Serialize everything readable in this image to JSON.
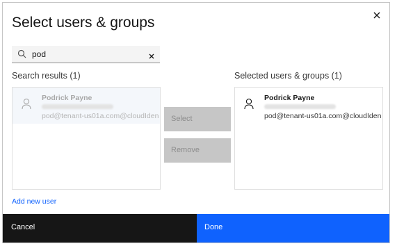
{
  "dialog": {
    "title": "Select users & groups"
  },
  "search": {
    "value": "pod",
    "icon": "search-icon",
    "clear_icon": "close-icon"
  },
  "results": {
    "label": "Search results (1)",
    "items": [
      {
        "name": "Podrick Payne",
        "email": "pod@tenant-us01a.com@cloudIden"
      }
    ]
  },
  "selected": {
    "label": "Selected users & groups (1)",
    "items": [
      {
        "name": "Podrick Payne",
        "email": "pod@tenant-us01a.com@cloudIden"
      }
    ]
  },
  "actions": {
    "select_label": "Select",
    "remove_label": "Remove"
  },
  "links": {
    "add_new_user": "Add new user"
  },
  "footer": {
    "cancel_label": "Cancel",
    "done_label": "Done"
  },
  "colors": {
    "primary": "#0f62fe",
    "secondary": "#161616",
    "disabled": "#c6c6c6"
  }
}
